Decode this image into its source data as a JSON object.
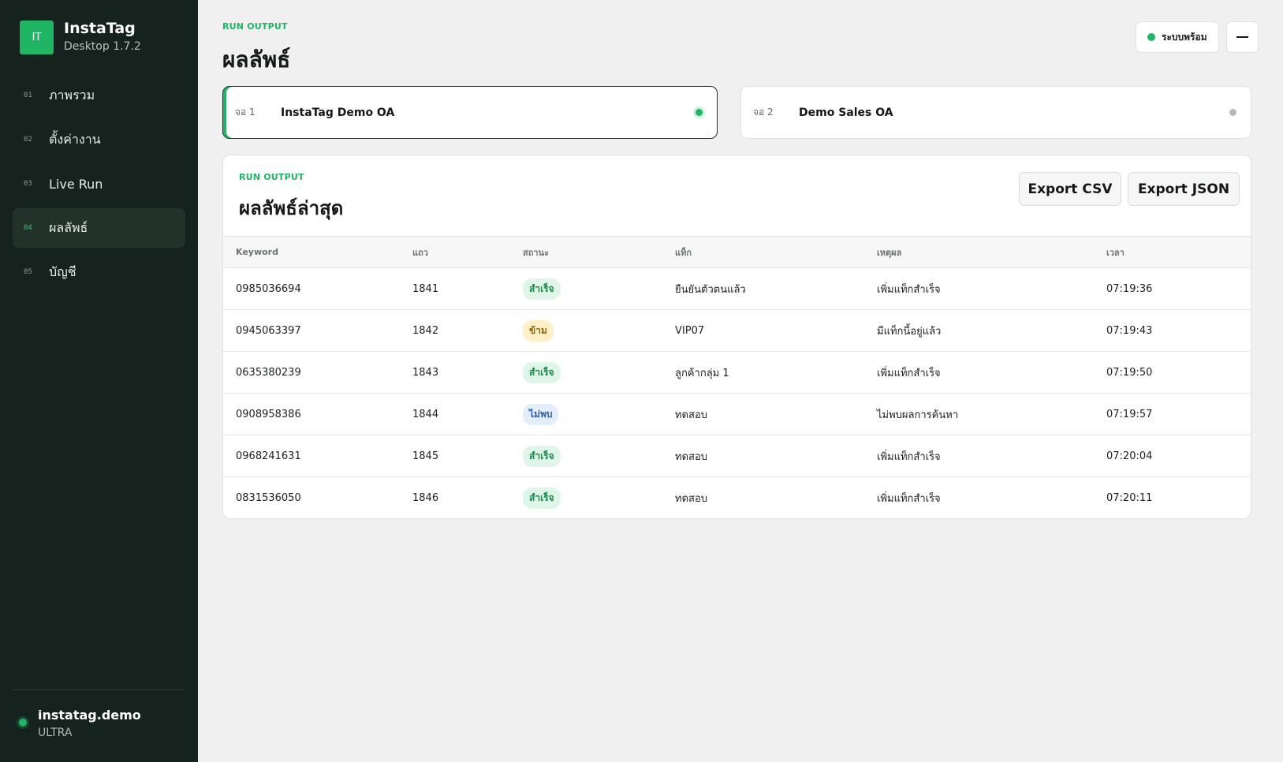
{
  "app": {
    "logo": "IT",
    "name": "InstaTag",
    "version": "Desktop 1.7.2"
  },
  "nav": [
    {
      "num": "01",
      "label": "ภาพรวม"
    },
    {
      "num": "02",
      "label": "ตั้งค่างาน"
    },
    {
      "num": "03",
      "label": "Live Run"
    },
    {
      "num": "04",
      "label": "ผลลัพธ์"
    },
    {
      "num": "05",
      "label": "บัญชี"
    }
  ],
  "user": {
    "name": "instatag.demo",
    "plan": "ULTRA"
  },
  "header": {
    "kicker": "RUN OUTPUT",
    "title": "ผลลัพธ์",
    "status": "ระบบพร้อม"
  },
  "screens": [
    {
      "num": "จอ 1",
      "name": "InstaTag Demo OA"
    },
    {
      "num": "จอ 2",
      "name": "Demo Sales OA"
    }
  ],
  "panel": {
    "kicker": "RUN OUTPUT",
    "title": "ผลลัพธ์ล่าสุด",
    "export_csv": "Export CSV",
    "export_json": "Export JSON"
  },
  "table": {
    "headers": [
      "Keyword",
      "แถว",
      "สถานะ",
      "แท็ก",
      "เหตุผล",
      "เวลา"
    ],
    "rows": [
      {
        "keyword": "0985036694",
        "row": "1841",
        "status": "สำเร็จ",
        "tag": "ยืนยันตัวตนแล้ว",
        "reason": "เพิ่มแท็กสำเร็จ",
        "time": "07:19:36"
      },
      {
        "keyword": "0945063397",
        "row": "1842",
        "status": "ข้าม",
        "tag": "VIP07",
        "reason": "มีแท็กนี้อยู่แล้ว",
        "time": "07:19:43"
      },
      {
        "keyword": "0635380239",
        "row": "1843",
        "status": "สำเร็จ",
        "tag": "ลูกค้ากลุ่ม 1",
        "reason": "เพิ่มแท็กสำเร็จ",
        "time": "07:19:50"
      },
      {
        "keyword": "0908958386",
        "row": "1844",
        "status": "ไม่พบ",
        "tag": "ทดสอบ",
        "reason": "ไม่พบผลการค้นหา",
        "time": "07:19:57"
      },
      {
        "keyword": "0968241631",
        "row": "1845",
        "status": "สำเร็จ",
        "tag": "ทดสอบ",
        "reason": "เพิ่มแท็กสำเร็จ",
        "time": "07:20:04"
      },
      {
        "keyword": "0831536050",
        "row": "1846",
        "status": "สำเร็จ",
        "tag": "ทดสอบ",
        "reason": "เพิ่มแท็กสำเร็จ",
        "time": "07:20:11"
      }
    ]
  },
  "colors": {
    "accent": "#1fb564",
    "sidebar": "#16221d",
    "background": "#eff0ef"
  }
}
